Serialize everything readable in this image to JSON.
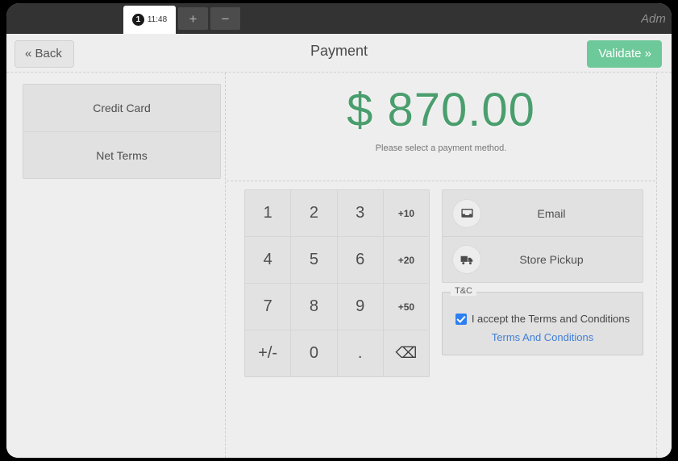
{
  "topbar": {
    "session_number": "1",
    "session_time": "11:48",
    "add_button": "+",
    "remove_button": "−",
    "user_label": "Adm"
  },
  "header": {
    "back_label": "« Back",
    "title": "Payment",
    "validate_label": "Validate »"
  },
  "payment_methods": [
    {
      "label": "Credit Card"
    },
    {
      "label": "Net Terms"
    }
  ],
  "amount": {
    "value": "$ 870.00",
    "hint": "Please select a payment method.",
    "color": "#4a9e6e"
  },
  "numpad": {
    "keys": [
      {
        "label": "1",
        "kind": "digit",
        "name": "numpad-key-1"
      },
      {
        "label": "2",
        "kind": "digit",
        "name": "numpad-key-2"
      },
      {
        "label": "3",
        "kind": "digit",
        "name": "numpad-key-3"
      },
      {
        "label": "+10",
        "kind": "small",
        "name": "numpad-key-plus-10"
      },
      {
        "label": "4",
        "kind": "digit",
        "name": "numpad-key-4"
      },
      {
        "label": "5",
        "kind": "digit",
        "name": "numpad-key-5"
      },
      {
        "label": "6",
        "kind": "digit",
        "name": "numpad-key-6"
      },
      {
        "label": "+20",
        "kind": "small",
        "name": "numpad-key-plus-20"
      },
      {
        "label": "7",
        "kind": "digit",
        "name": "numpad-key-7"
      },
      {
        "label": "8",
        "kind": "digit",
        "name": "numpad-key-8"
      },
      {
        "label": "9",
        "kind": "digit",
        "name": "numpad-key-9"
      },
      {
        "label": "+50",
        "kind": "small",
        "name": "numpad-key-plus-50"
      },
      {
        "label": "+/-",
        "kind": "digit",
        "name": "numpad-key-sign"
      },
      {
        "label": "0",
        "kind": "digit",
        "name": "numpad-key-0"
      },
      {
        "label": ".",
        "kind": "digit",
        "name": "numpad-key-decimal"
      },
      {
        "label": "⌫",
        "kind": "icon",
        "name": "numpad-key-backspace"
      }
    ]
  },
  "options": [
    {
      "label": "Email",
      "icon": "inbox-icon"
    },
    {
      "label": "Store Pickup",
      "icon": "truck-icon"
    }
  ],
  "terms": {
    "legend": "T&C",
    "accept_label": "I accept the Terms and Conditions",
    "link_label": "Terms And Conditions",
    "checked": true,
    "checkbox_color": "#2d7ff2",
    "link_color": "#3f7fd8"
  }
}
